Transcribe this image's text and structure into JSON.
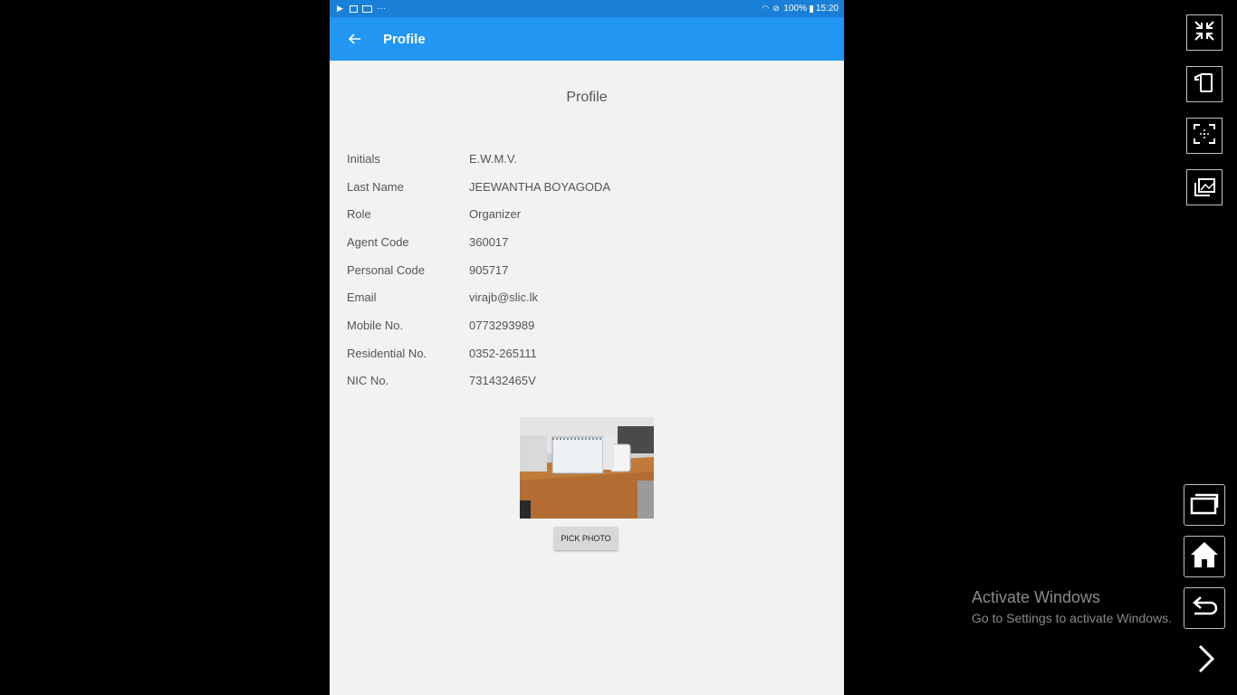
{
  "status_bar": {
    "battery": "100%",
    "time": "15:20",
    "more": "···"
  },
  "app_bar": {
    "title": "Profile"
  },
  "page": {
    "heading": "Profile"
  },
  "profile_fields": [
    {
      "label": "Initials",
      "value": "E.W.M.V."
    },
    {
      "label": "Last Name",
      "value": "JEEWANTHA BOYAGODA"
    },
    {
      "label": "Role",
      "value": "Organizer"
    },
    {
      "label": "Agent Code",
      "value": "360017"
    },
    {
      "label": "Personal Code",
      "value": "905717"
    },
    {
      "label": "Email",
      "value": "virajb@slic.lk"
    },
    {
      "label": "Mobile No.",
      "value": "0773293989"
    },
    {
      "label": "Residential No.",
      "value": "0352-265111"
    },
    {
      "label": "NIC No.",
      "value": "731432465V"
    }
  ],
  "photo": {
    "pick_label": "PICK PHOTO"
  },
  "watermark": {
    "title": "Activate Windows",
    "subtitle": "Go to Settings to activate Windows."
  },
  "side_controls": {
    "icons": [
      "collapse-icon",
      "rotate-icon",
      "screenshot-icon",
      "gallery-icon"
    ],
    "nav_icons": [
      "recents-icon",
      "home-icon",
      "back-icon",
      "chevron-right-icon"
    ]
  },
  "colors": {
    "app_bar": "#2196f3",
    "status_bar": "#1a7fd6",
    "page_background": "#f2f2f2"
  }
}
